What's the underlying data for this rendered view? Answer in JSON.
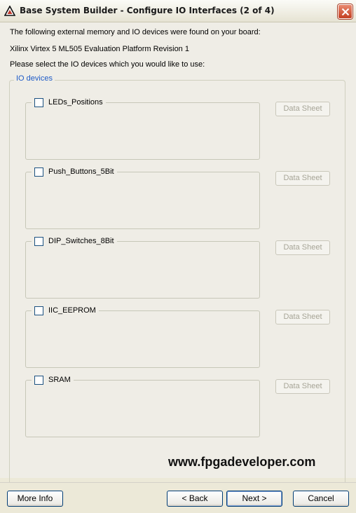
{
  "window": {
    "title": "Base System Builder - Configure IO Interfaces (2 of 4)",
    "icon": "xilinx-logo-icon"
  },
  "intro": {
    "line1": "The following external memory and IO devices were found on your board:",
    "line2": "Xilinx Virtex 5 ML505 Evaluation Platform Revision 1",
    "line3": "Please select the IO devices which you would like to use:"
  },
  "group": {
    "title": "IO devices"
  },
  "devices": [
    {
      "name": "LEDs_Positions",
      "checked": false,
      "button": "Data Sheet"
    },
    {
      "name": "Push_Buttons_5Bit",
      "checked": false,
      "button": "Data Sheet"
    },
    {
      "name": "DIP_Switches_8Bit",
      "checked": false,
      "button": "Data Sheet"
    },
    {
      "name": "IIC_EEPROM",
      "checked": false,
      "button": "Data Sheet"
    },
    {
      "name": "SRAM",
      "checked": false,
      "button": "Data Sheet"
    }
  ],
  "watermark": "www.fpgadeveloper.com",
  "footer": {
    "more_info": "More Info",
    "back": "< Back",
    "next": "Next >",
    "cancel": "Cancel"
  },
  "colors": {
    "legend": "#1f5bc7",
    "close_button": "#c33f22",
    "button_border": "#003c74"
  }
}
